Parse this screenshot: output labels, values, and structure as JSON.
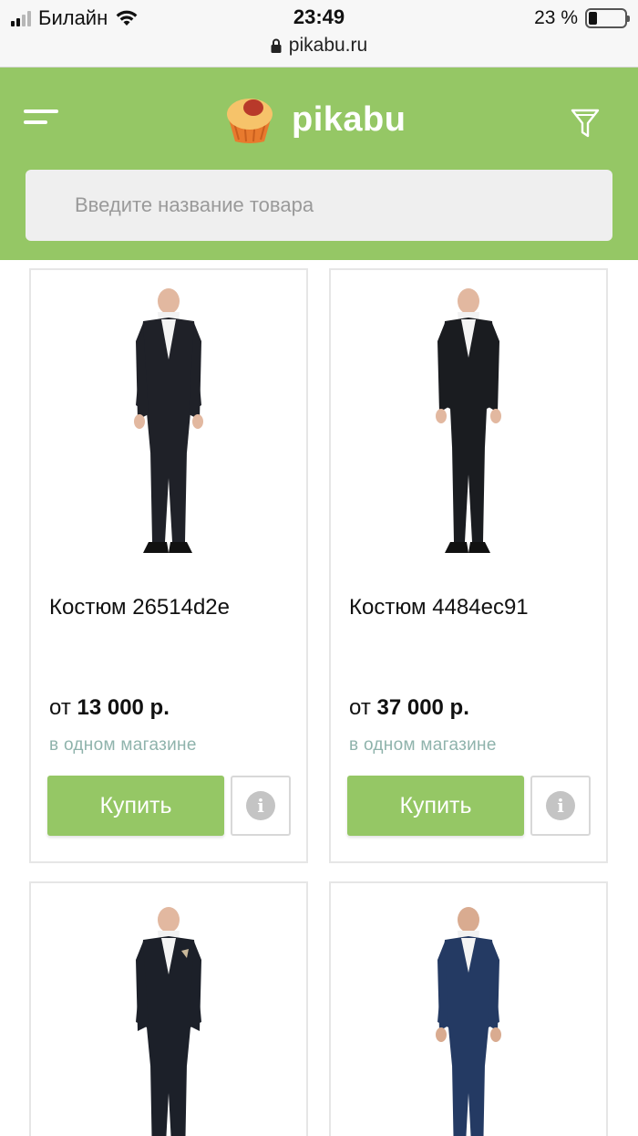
{
  "status_bar": {
    "carrier": "Билайн",
    "time": "23:49",
    "url": "pikabu.ru",
    "battery_text": "23 %",
    "battery_level": 0.23
  },
  "header": {
    "logo_text": "pikabu",
    "menu_icon": "hamburger-icon",
    "filter_icon": "filter-icon",
    "search_placeholder": "Введите название товара"
  },
  "products": [
    {
      "title": "Костюм 26514d2e",
      "price_prefix": "от",
      "price": "13 000 р.",
      "stores": "в одном магазине",
      "buy_label": "Купить",
      "info_label": "i",
      "suit_color": "#1f2128"
    },
    {
      "title": "Костюм 4484ec91",
      "price_prefix": "от",
      "price": "37 000 р.",
      "stores": "в одном магазине",
      "buy_label": "Купить",
      "info_label": "i",
      "suit_color": "#1a1c20"
    },
    {
      "suit_color": "#1c2029"
    },
    {
      "suit_color": "#243a63"
    }
  ],
  "colors": {
    "brand_green": "#95c765",
    "stores_text": "#8fb3ac",
    "logo_orange": "#e87a2e"
  }
}
